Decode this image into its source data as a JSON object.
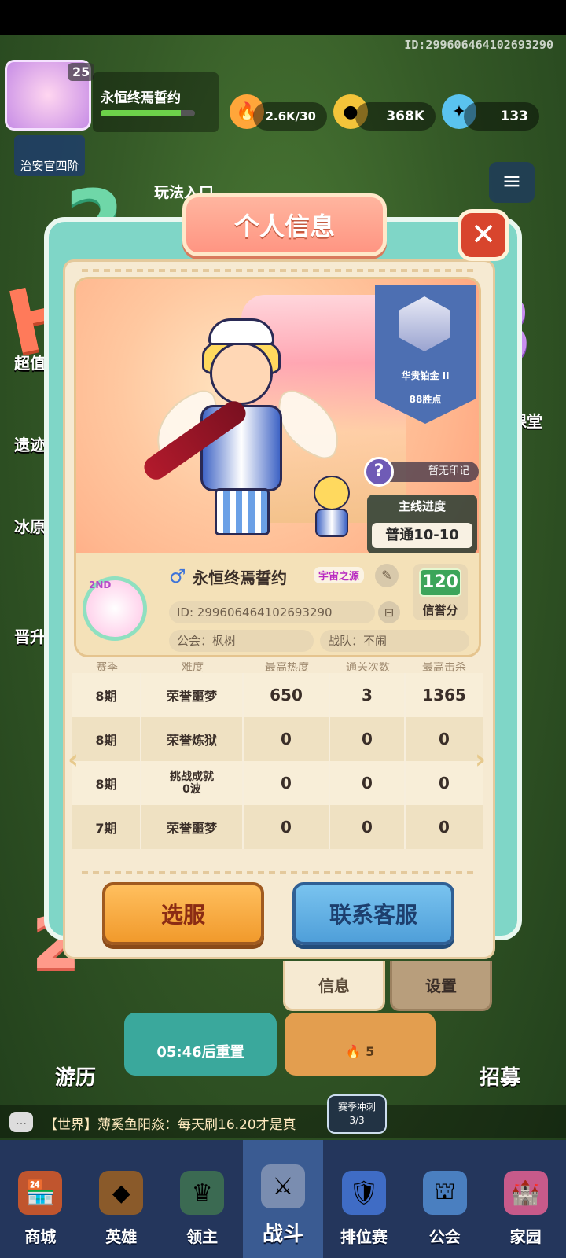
{
  "top": {
    "id_watermark": "ID:299606464102693290",
    "level": "25",
    "player_name": "永恒终焉誓约",
    "energy": "2.6K/30",
    "gold": "368K",
    "gems": "133",
    "guild_rank_label": "治安官四阶",
    "play_entry": "玩法入口"
  },
  "side_labels": [
    "超值",
    "遗迹",
    "冰原",
    "晋升",
    "课堂"
  ],
  "modal": {
    "title": "个人信息",
    "rank": {
      "name": "华贵铂金 II",
      "points": "88胜点"
    },
    "mark": "暂无印记",
    "progress": {
      "title": "主线进度",
      "value": "普通10-10"
    },
    "profile": {
      "gender_icon": "♂",
      "name": "永恒终焉誓约",
      "title_tag": "宇宙之源",
      "id": "ID: 299606464102693290",
      "guild": "公会：枫树",
      "team": "战队：不闹",
      "credit_value": "120",
      "credit_label": "信誉分",
      "avatar_badge": "2ND"
    },
    "table": {
      "headers": [
        "赛季",
        "难度",
        "最高热度",
        "通关次数",
        "最高击杀"
      ],
      "rows": [
        [
          "8期",
          "荣誉噩梦",
          "650",
          "3",
          "1365"
        ],
        [
          "8期",
          "荣誉炼狱",
          "0",
          "0",
          "0"
        ],
        [
          "8期",
          "挑战成就\n0波",
          "0",
          "0",
          "0"
        ],
        [
          "7期",
          "荣誉噩梦",
          "0",
          "0",
          "0"
        ]
      ]
    },
    "buttons": {
      "select_server": "选服",
      "contact_support": "联系客服"
    },
    "tabs": {
      "info": "信息",
      "settings": "设置"
    }
  },
  "background": {
    "card1_text": "05:46后重置",
    "card2_count": "5",
    "travel": "游历",
    "recruit": "招募"
  },
  "chat": {
    "text": "【世界】薄奚鱼阳焱：每天刷16.20才是真",
    "season_badge_line1": "赛季冲刺",
    "season_badge_line2": "3/3"
  },
  "nav": [
    {
      "label": "商城",
      "icon": "shop-icon"
    },
    {
      "label": "英雄",
      "icon": "hero-icon"
    },
    {
      "label": "领主",
      "icon": "lord-icon"
    },
    {
      "label": "战斗",
      "icon": "battle-icon"
    },
    {
      "label": "排位赛",
      "icon": "ranked-icon"
    },
    {
      "label": "公会",
      "icon": "guild-icon"
    },
    {
      "label": "家园",
      "icon": "home-icon"
    }
  ],
  "colors": {
    "modal_teal": "#7fd6c7",
    "panel_cream": "#f6ead2",
    "accent_orange": "#f19a2c",
    "accent_blue": "#4f9fd9",
    "rank_blue": "#4d6fb2"
  }
}
